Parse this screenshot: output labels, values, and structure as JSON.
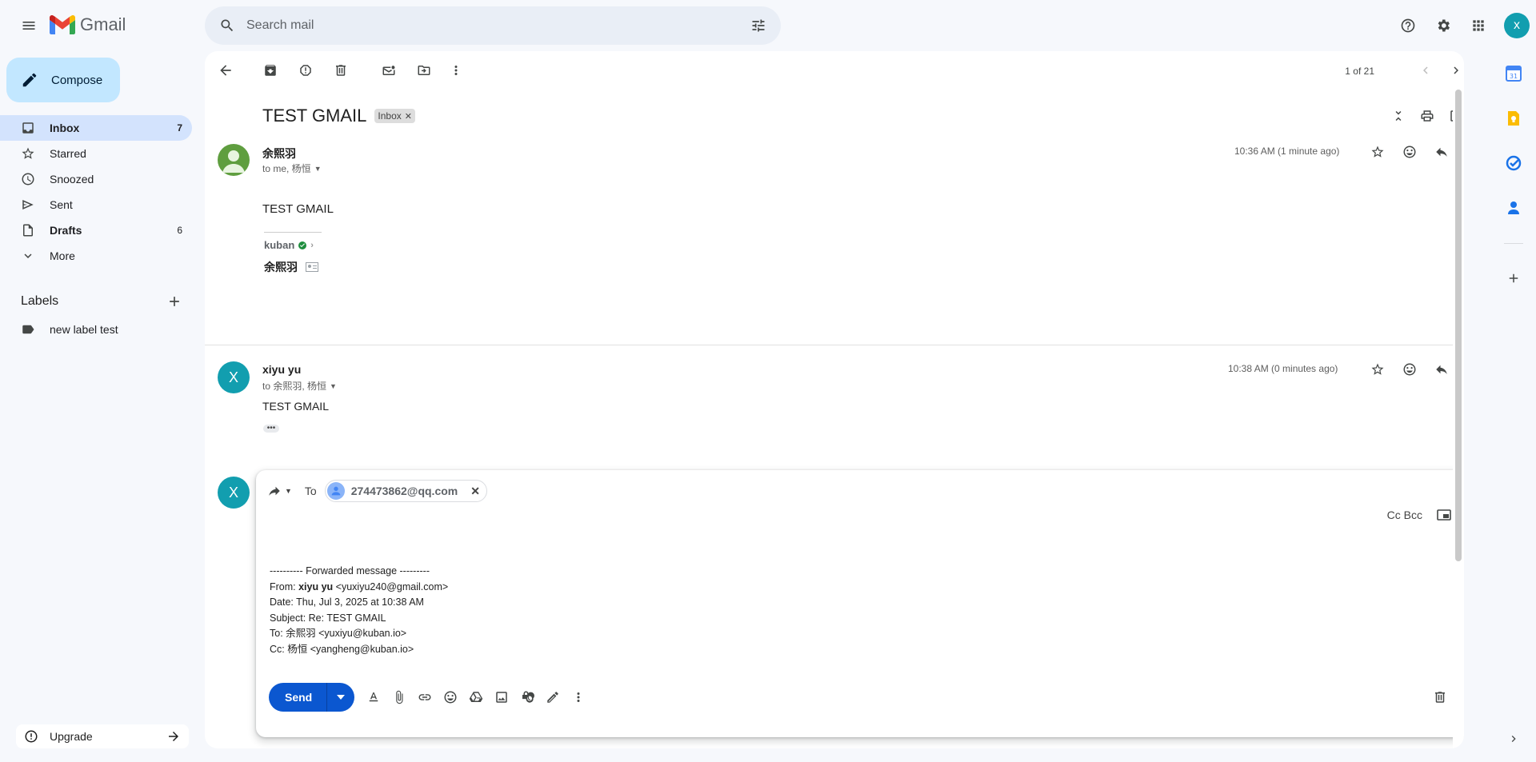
{
  "header": {
    "app_name": "Gmail",
    "search_placeholder": "Search mail",
    "avatar_letter": "x"
  },
  "sidebar": {
    "compose_label": "Compose",
    "items": [
      {
        "label": "Inbox",
        "count": "7",
        "icon": "inbox-icon"
      },
      {
        "label": "Starred",
        "count": "",
        "icon": "star-icon"
      },
      {
        "label": "Snoozed",
        "count": "",
        "icon": "clock-icon"
      },
      {
        "label": "Sent",
        "count": "",
        "icon": "send-icon"
      },
      {
        "label": "Drafts",
        "count": "6",
        "icon": "draft-icon"
      },
      {
        "label": "More",
        "count": "",
        "icon": "chevron-down-icon"
      }
    ],
    "labels_heading": "Labels",
    "labels": [
      {
        "label": "new label test"
      }
    ],
    "upgrade_label": "Upgrade"
  },
  "toolbar": {
    "pager": "1 of 21"
  },
  "thread": {
    "subject": "TEST GMAIL",
    "label_chip": "Inbox",
    "messages": [
      {
        "sender": "余熙羽",
        "recipients": "to me, 杨恒",
        "time": "10:36 AM (1 minute ago)",
        "body": "TEST GMAIL",
        "signature_company": "kuban",
        "signature_name": "余熙羽"
      },
      {
        "sender": "xiyu yu",
        "avatar_letter": "X",
        "recipients": "to 余熙羽, 杨恒",
        "time": "10:38 AM (0 minutes ago)",
        "body": "TEST GMAIL",
        "collapsed_indicator": "•••"
      }
    ]
  },
  "reply": {
    "avatar_letter": "X",
    "to_label": "To",
    "recipient": "274473862@qq.com",
    "cc_bcc": "Cc Bcc",
    "forwarded": {
      "separator": "---------- Forwarded message ---------",
      "from_label": "From: ",
      "from_name": "xiyu yu",
      "from_email": " <yuxiyu240@gmail.com>",
      "date": "Date: Thu, Jul 3, 2025 at 10:38 AM",
      "subject": "Subject: Re: TEST GMAIL",
      "to": "To: 余熙羽 <yuxiyu@kuban.io>",
      "cc": "Cc: 杨恒 <yangheng@kuban.io>"
    },
    "send_label": "Send"
  },
  "colors": {
    "accent": "#0b57d0",
    "compose_bg": "#c2e7ff",
    "active_nav": "#d3e3fd",
    "avatar_teal": "#129eaf",
    "avatar_green": "#5f9e3f"
  }
}
